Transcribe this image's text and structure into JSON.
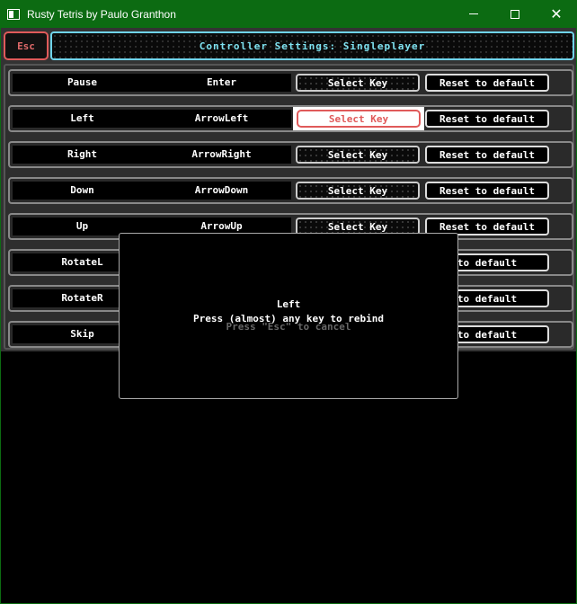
{
  "window": {
    "title": "Rusty Tetris by Paulo Granthon",
    "close_glyph": "✕"
  },
  "header": {
    "esc_label": "Esc",
    "title": "Controller Settings: Singleplayer"
  },
  "bindings": [
    {
      "action": "Pause",
      "key": "Enter",
      "select_label": "Select Key",
      "reset_label": "Reset to default"
    },
    {
      "action": "Left",
      "key": "ArrowLeft",
      "select_label": "Select Key",
      "reset_label": "Reset to default"
    },
    {
      "action": "Right",
      "key": "ArrowRight",
      "select_label": "Select Key",
      "reset_label": "Reset to default"
    },
    {
      "action": "Down",
      "key": "ArrowDown",
      "select_label": "Select Key",
      "reset_label": "Reset to default"
    },
    {
      "action": "Up",
      "key": "ArrowUp",
      "select_label": "Select Key",
      "reset_label": "Reset to default"
    },
    {
      "action": "RotateL",
      "key": "",
      "select_label": "",
      "reset_label": "to default"
    },
    {
      "action": "RotateR",
      "key": "",
      "select_label": "",
      "reset_label": "to default"
    },
    {
      "action": "Skip",
      "key": "",
      "select_label": "",
      "reset_label": "to default"
    }
  ],
  "modal": {
    "action": "Left",
    "prompt": "Press (almost) any key to rebind",
    "cancel_hint": "Press \"Esc\" to cancel"
  },
  "colors": {
    "titlebar": "#0c6b12",
    "accent_red": "#e05a5a",
    "accent_cyan": "#6fd3ea"
  }
}
